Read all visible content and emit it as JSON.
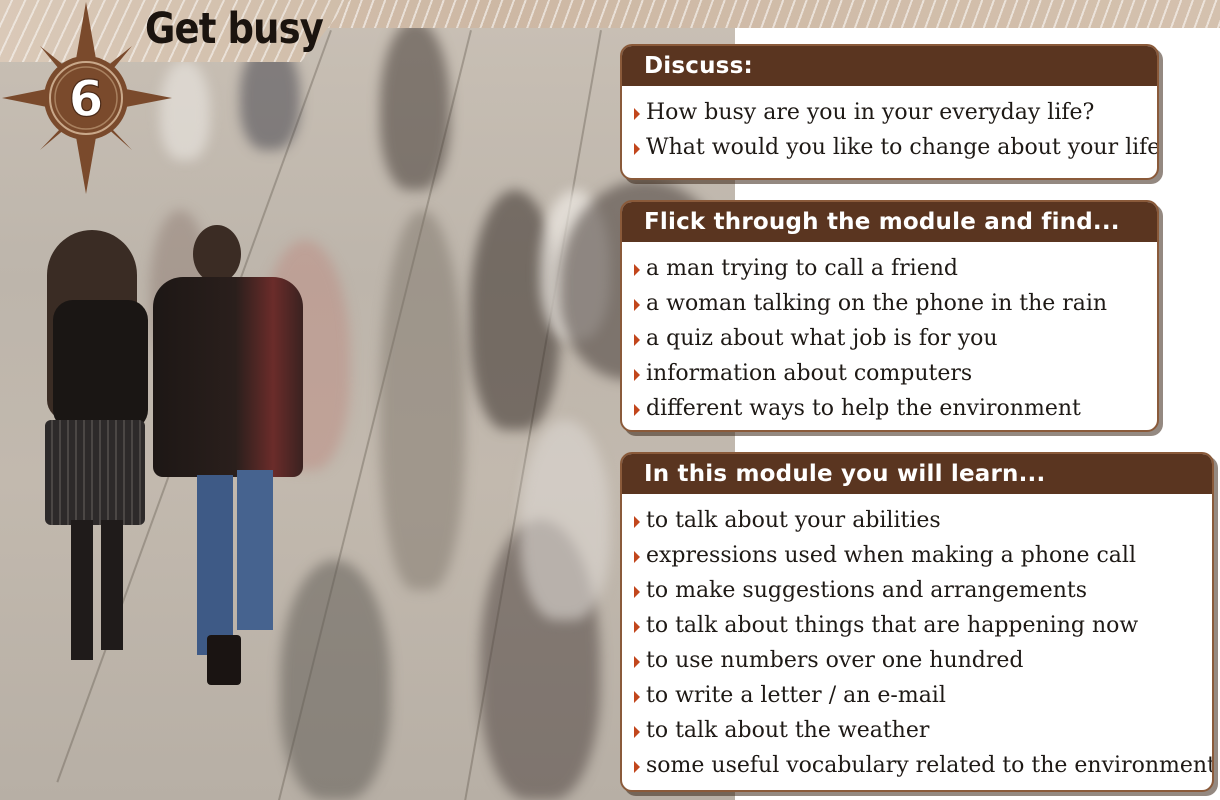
{
  "module": {
    "number": "6",
    "title": "Get busy"
  },
  "discuss": {
    "heading": "Discuss:",
    "items": [
      "How busy are you in your everyday life?",
      "What would you like to change about your life?"
    ]
  },
  "flick": {
    "heading": "Flick through the module and find...",
    "items": [
      "a man trying to call a friend",
      "a woman talking on the phone in the rain",
      "a quiz about what job is for you",
      "information about computers",
      "different ways to help the environment"
    ]
  },
  "learn": {
    "heading": "In this module you will learn...",
    "items": [
      "to talk about your abilities",
      "expressions used when making a phone call",
      "to make suggestions and arrangements",
      "to talk about things that are happening now",
      "to use numbers over one hundred",
      "to write a letter / an e-mail",
      "to talk about the weather",
      "some useful vocabulary related to the environment"
    ]
  },
  "colors": {
    "heading_bg": "#5a3520",
    "bullet": "#c2461c",
    "badge": "#7a4a2c"
  },
  "photo": {
    "icon": "crowd-walking-photo"
  }
}
